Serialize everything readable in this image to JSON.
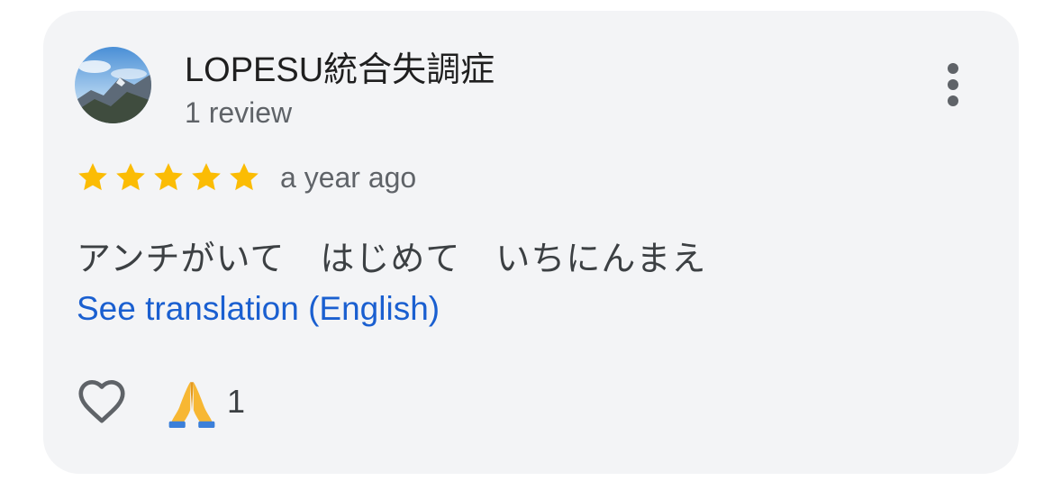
{
  "review": {
    "author_name": "LOPESU統合失調症",
    "author_review_count": "1 review",
    "rating": 5,
    "rating_max": 5,
    "time_ago": "a year ago",
    "text": "アンチがいて　はじめて　いちにんまえ",
    "translate_link": "See translation (English)",
    "reaction_count": "1"
  },
  "icons": {
    "avatar": "mountain-photo-avatar",
    "more": "more-vert-icon",
    "like": "heart-outline-icon",
    "reaction": "folded-hands-emoji"
  },
  "colors": {
    "card_bg": "#f3f4f6",
    "star": "#fbbc04",
    "link": "#1a5fd0",
    "secondary_text": "#5f6368"
  }
}
